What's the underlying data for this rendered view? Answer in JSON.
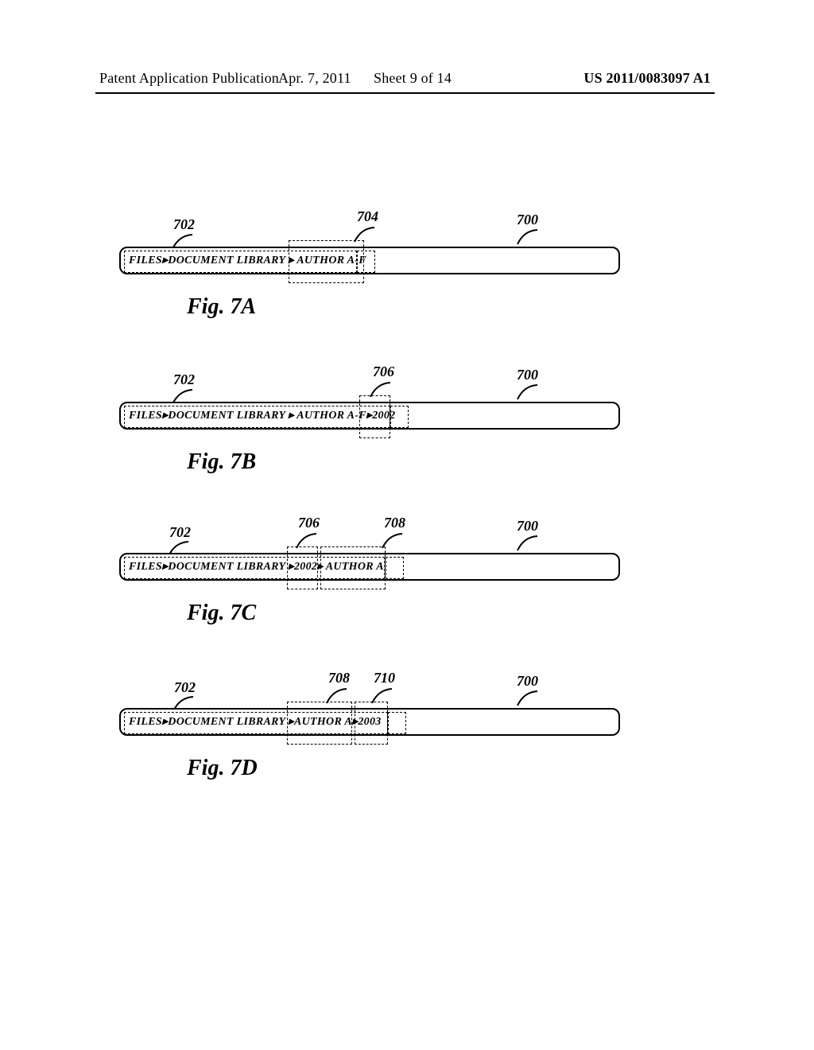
{
  "header": {
    "left": "Patent Application Publication",
    "mid_date": "Apr. 7, 2011",
    "mid_sheet": "Sheet 9 of 14",
    "right": "US 2011/0083097 A1"
  },
  "figA": {
    "addr": "FILES▸DOCUMENT LIBRARY ▸ AUTHOR A-F",
    "caption": "Fig. 7A",
    "ref702": "702",
    "ref704": "704",
    "ref700": "700"
  },
  "figB": {
    "addr": "FILES▸DOCUMENT LIBRARY ▸ AUTHOR A-F▸2002",
    "caption": "Fig. 7B",
    "ref702": "702",
    "ref706": "706",
    "ref700": "700"
  },
  "figC": {
    "addr": "FILES▸DOCUMENT LIBRARY ▸2002▸ AUTHOR A",
    "caption": "Fig. 7C",
    "ref702": "702",
    "ref706": "706",
    "ref708": "708",
    "ref700": "700"
  },
  "figD": {
    "addr": "FILES▸DOCUMENT LIBRARY ▸AUTHOR A▸2003",
    "caption": "Fig. 7D",
    "ref702": "702",
    "ref708": "708",
    "ref710": "710",
    "ref700": "700"
  }
}
